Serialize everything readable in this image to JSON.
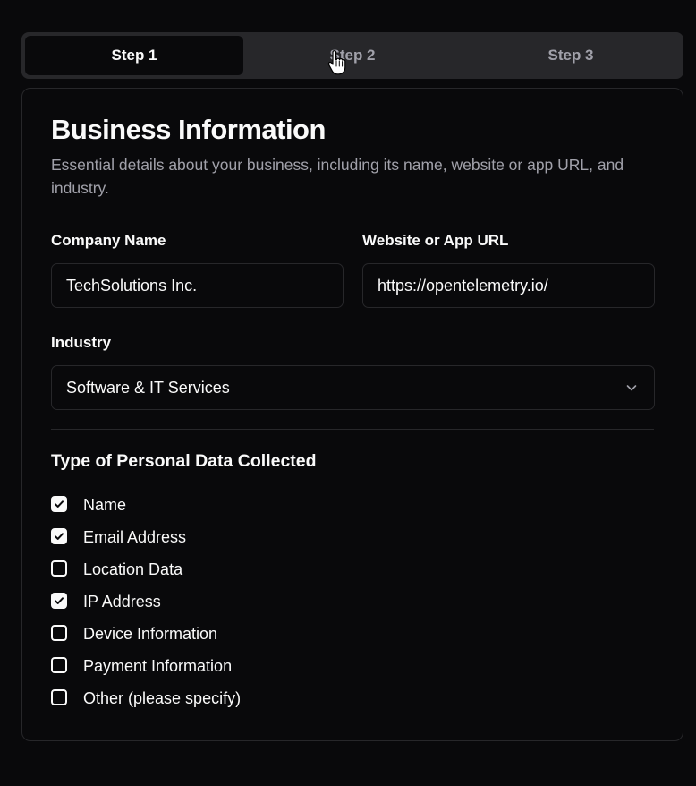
{
  "steps": {
    "tabs": [
      {
        "label": "Step 1",
        "active": true
      },
      {
        "label": "Step 2",
        "active": false
      },
      {
        "label": "Step 3",
        "active": false
      }
    ]
  },
  "form": {
    "title": "Business Information",
    "description": "Essential details about your business, including its name, website or app URL, and industry.",
    "company_name": {
      "label": "Company Name",
      "value": "TechSolutions Inc."
    },
    "website": {
      "label": "Website or App URL",
      "value": "https://opentelemetry.io/"
    },
    "industry": {
      "label": "Industry",
      "value": "Software & IT Services"
    },
    "personal_data": {
      "title": "Type of Personal Data Collected",
      "options": [
        {
          "label": "Name",
          "checked": true
        },
        {
          "label": "Email Address",
          "checked": true
        },
        {
          "label": "Location Data",
          "checked": false
        },
        {
          "label": "IP Address",
          "checked": true
        },
        {
          "label": "Device Information",
          "checked": false
        },
        {
          "label": "Payment Information",
          "checked": false
        },
        {
          "label": "Other (please specify)",
          "checked": false
        }
      ]
    }
  },
  "icons": {
    "cursor": "hand-pointer-icon",
    "select": "chevron-down-icon",
    "check": "checkmark-icon"
  },
  "colors": {
    "background": "#09090b",
    "tab_bar": "#27272a",
    "border": "#27272a",
    "text": "#fafafa",
    "muted": "#a1a1aa"
  }
}
